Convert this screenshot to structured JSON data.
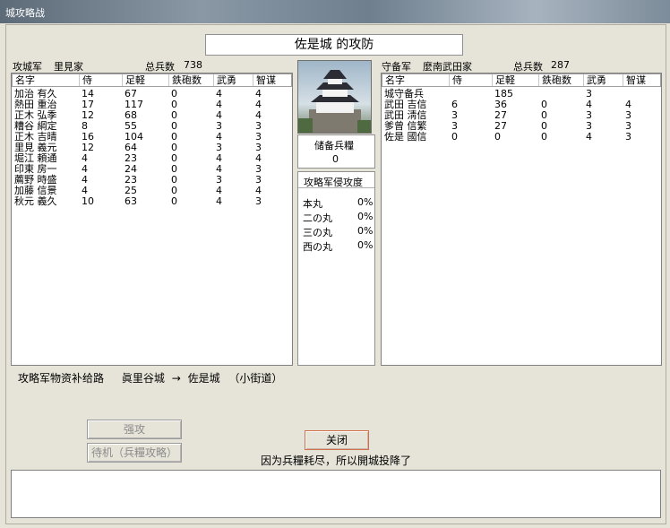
{
  "window": {
    "title": "城攻略战"
  },
  "battle_title": "佐是城 的攻防",
  "attack": {
    "side_label": "攻城军",
    "clan": "里見家",
    "total_label": "总兵数",
    "total": "738",
    "columns": [
      "名字",
      "侍",
      "足軽",
      "鉄砲数",
      "武勇",
      "智谋"
    ],
    "rows": [
      [
        "加治 有久",
        "14",
        "67",
        "0",
        "4",
        "4"
      ],
      [
        "熱田 重治",
        "17",
        "117",
        "0",
        "4",
        "4"
      ],
      [
        "正木 弘季",
        "12",
        "68",
        "0",
        "4",
        "4"
      ],
      [
        "糟谷 綱定",
        "8",
        "55",
        "0",
        "3",
        "3"
      ],
      [
        "正木 吉晴",
        "16",
        "104",
        "0",
        "4",
        "3"
      ],
      [
        "里見 義元",
        "12",
        "64",
        "0",
        "3",
        "3"
      ],
      [
        "堀江 頼通",
        "4",
        "23",
        "0",
        "4",
        "4"
      ],
      [
        "印東 房一",
        "4",
        "24",
        "0",
        "4",
        "3"
      ],
      [
        "薦野 時盛",
        "4",
        "23",
        "0",
        "3",
        "3"
      ],
      [
        "加藤 信景",
        "4",
        "25",
        "0",
        "4",
        "4"
      ],
      [
        "秋元 義久",
        "10",
        "63",
        "0",
        "4",
        "3"
      ]
    ]
  },
  "center": {
    "provisions_label": "储备兵糧",
    "provisions_value": "0",
    "invasion_label": "攻略军侵攻度",
    "invasion": [
      {
        "name": "本丸",
        "value": "0%"
      },
      {
        "name": "二の丸",
        "value": "0%"
      },
      {
        "name": "三の丸",
        "value": "0%"
      },
      {
        "name": "西の丸",
        "value": "0%"
      }
    ]
  },
  "defense": {
    "side_label": "守备军",
    "clan": "麼南武田家",
    "total_label": "总兵数",
    "total": "287",
    "columns": [
      "名字",
      "侍",
      "足軽",
      "鉄砲数",
      "武勇",
      "智谋"
    ],
    "rows": [
      [
        "城守备兵",
        "",
        "185",
        "",
        "3",
        ""
      ],
      [
        "武田 吉信",
        "6",
        "36",
        "0",
        "4",
        "4"
      ],
      [
        "武田 淸信",
        "3",
        "27",
        "0",
        "3",
        "3"
      ],
      [
        "爹曾 信繁",
        "3",
        "27",
        "0",
        "3",
        "3"
      ],
      [
        "佐是 國信",
        "0",
        "0",
        "0",
        "4",
        "3"
      ]
    ]
  },
  "supply": {
    "label": "攻略军物资补给路",
    "from": "眞里谷城",
    "arrow": "→",
    "to": "佐是城",
    "road": "（小街道）"
  },
  "buttons": {
    "assault": "强攻",
    "wait": "待机（兵糧攻略）",
    "close": "关闭"
  },
  "message": "因为兵糧耗尽，所以開城投降了"
}
